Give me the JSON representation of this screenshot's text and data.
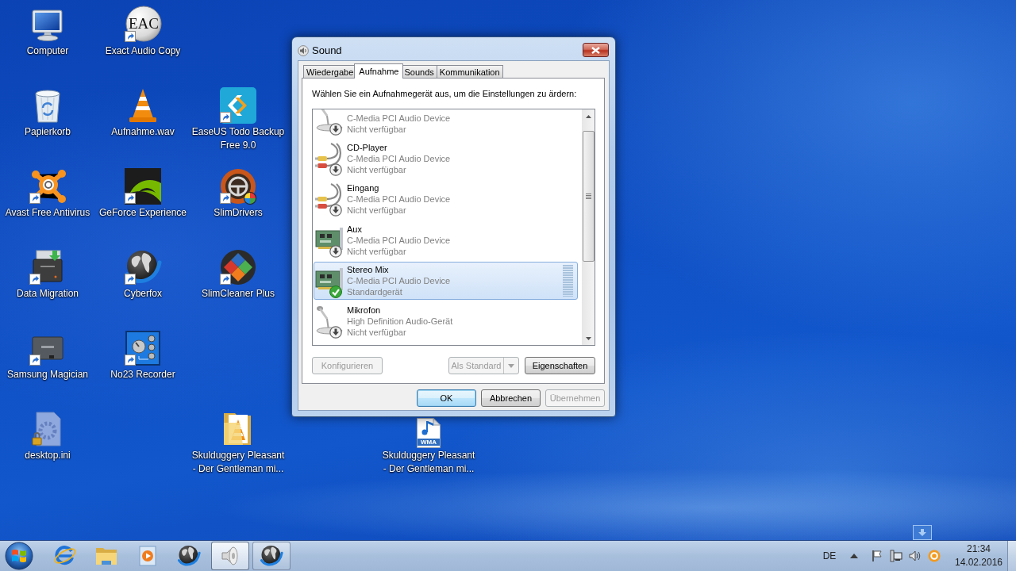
{
  "desktop": {
    "icons": [
      {
        "label": "Computer",
        "kind": "computer",
        "shortcut": false
      },
      {
        "label": "Exact Audio Copy",
        "kind": "disc",
        "shortcut": true,
        "logo": "EAC"
      },
      {
        "label": "Papierkorb",
        "kind": "bin",
        "shortcut": false
      },
      {
        "label": "Aufnahme.wav",
        "kind": "cone",
        "shortcut": false
      },
      {
        "label": "EaseUS Todo Backup Free 9.0",
        "kind": "chevrons",
        "shortcut": true
      },
      {
        "label": "Avast Free Antivirus",
        "kind": "splat",
        "shortcut": true
      },
      {
        "label": "GeForce Experience",
        "kind": "eye",
        "shortcut": true
      },
      {
        "label": "SlimDrivers",
        "kind": "wheel",
        "shortcut": true
      },
      {
        "label": "Data Migration",
        "kind": "migration",
        "shortcut": true
      },
      {
        "label": "Cyberfox",
        "kind": "globe",
        "shortcut": true
      },
      {
        "label": "SlimCleaner Plus",
        "kind": "cleaner",
        "shortcut": true
      },
      {
        "label": "Samsung Magician",
        "kind": "drive",
        "shortcut": true
      },
      {
        "label": "No23 Recorder",
        "kind": "knob",
        "shortcut": true
      },
      {
        "label": "desktop.ini",
        "kind": "settings",
        "shortcut": false
      },
      {
        "label": "Skulduggery Pleasant - Der Gentleman mi...",
        "kind": "folder",
        "shortcut": false
      },
      {
        "label": "Skulduggery Pleasant - Der Gentleman mi...",
        "kind": "music",
        "shortcut": false,
        "logo": "WMA"
      }
    ]
  },
  "dialog": {
    "title": "Sound",
    "tabs": [
      {
        "label": "Wiedergabe",
        "selected": false
      },
      {
        "label": "Aufnahme",
        "selected": true
      },
      {
        "label": "Sounds",
        "selected": false
      },
      {
        "label": "Kommunikation",
        "selected": false
      }
    ],
    "instruction": "Wählen Sie ein Aufnahmegerät aus, um die Einstellungen zu ärdern:",
    "devices": [
      {
        "kind": "microphone",
        "device": "C-Media PCI Audio Device",
        "status": "Nicht verfügbar",
        "default": false,
        "selected": false
      },
      {
        "kind": "cable",
        "name": "CD-Player",
        "device": "C-Media PCI Audio Device",
        "status": "Nicht verfügbar",
        "default": false,
        "selected": false
      },
      {
        "kind": "cable",
        "name": "Eingang",
        "device": "C-Media PCI Audio Device",
        "status": "Nicht verfügbar",
        "default": false,
        "selected": false
      },
      {
        "kind": "card",
        "name": "Aux",
        "device": "C-Media PCI Audio Device",
        "status": "Nicht verfügbar",
        "default": false,
        "selected": false
      },
      {
        "kind": "card",
        "name": "Stereo Mix",
        "device": "C-Media PCI Audio Device",
        "status": "Standardgerät",
        "default": true,
        "selected": true,
        "level": 0
      },
      {
        "kind": "microphone",
        "name": "Mikrofon",
        "device": "High Definition Audio-Gerät",
        "status": "Nicht verfügbar",
        "default": false,
        "selected": false
      }
    ],
    "panel_buttons": [
      {
        "label": "Konfigurieren",
        "kind": "push",
        "disabled": true
      },
      {
        "label": "Als Standard",
        "kind": "split",
        "disabled": true
      },
      {
        "label": "Eigenschaften",
        "kind": "push",
        "disabled": false
      }
    ],
    "buttons": [
      {
        "label": "OK",
        "default": true,
        "disabled": false
      },
      {
        "label": "Abbrechen",
        "default": false,
        "disabled": false
      },
      {
        "label": "Übernehmen",
        "default": false,
        "disabled": true
      }
    ]
  },
  "taskbar": {
    "items": [
      {
        "kind": "browser",
        "running": false,
        "selected": false
      },
      {
        "kind": "explorer",
        "running": false,
        "selected": false
      },
      {
        "kind": "player",
        "running": false,
        "selected": false
      },
      {
        "kind": "globe",
        "running": false,
        "selected": false
      },
      {
        "kind": "speaker",
        "running": true,
        "selected": true
      },
      {
        "kind": "globe",
        "running": true,
        "selected": false
      }
    ],
    "language": "DE",
    "clock": {
      "time": "21:34",
      "date": "14.02.2016"
    }
  }
}
